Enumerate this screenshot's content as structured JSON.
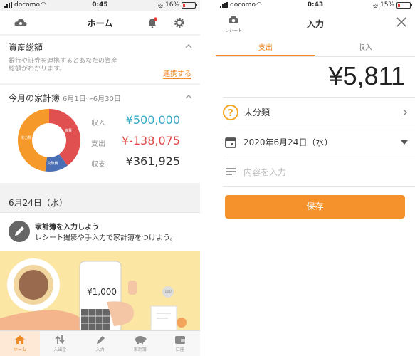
{
  "left": {
    "status": {
      "carrier": "docomo",
      "time": "0:45",
      "battery": "16%"
    },
    "nav": {
      "title": "ホーム",
      "cloud_icon": "cloud-icon",
      "bell_icon": "bell-icon",
      "gear_icon": "gear-icon"
    },
    "assets": {
      "title": "資産総額",
      "desc_line1": "銀行や証券を連携するとあなたの資産",
      "desc_line2": "総額がわかります。",
      "link": "連携する"
    },
    "monthly": {
      "title": "今月の家計簿",
      "range": "6月1日〜6月30日",
      "income_label": "収入",
      "income_value": "¥500,000",
      "expense_label": "支出",
      "expense_value": "¥-138,075",
      "balance_label": "収支",
      "balance_value": "¥361,925",
      "donut_labels": [
        "食費",
        "交際費",
        "未分類"
      ]
    },
    "date_header": "6月24日（水）",
    "prompt": {
      "title": "家計簿を入力しよう",
      "desc": "レシート撮影や手入力で家計簿をつけよう。"
    },
    "illustration": {
      "phone_amount": "¥1,000",
      "coin": "100"
    },
    "tabs": [
      "ホーム",
      "入出金",
      "入力",
      "家計簿",
      "口座"
    ]
  },
  "right": {
    "status": {
      "carrier": "docomo",
      "time": "0:43",
      "battery": "15%"
    },
    "nav": {
      "title": "入力",
      "receipt_label": "レシート"
    },
    "segments": [
      "支出",
      "収入"
    ],
    "amount": "¥5,811",
    "category": "未分類",
    "date": "2020年6月24日（水）",
    "memo_placeholder": "内容を入力",
    "save_label": "保存"
  },
  "colors": {
    "accent": "#f08a24",
    "income": "#38a8c8",
    "expense": "#e04848",
    "donut_food": "#e05050",
    "donut_social": "#4a6fb5",
    "donut_unclassified": "#f59a2a",
    "illustration_bg": "#fbe7a3"
  },
  "donut_share": {
    "food": 0.4,
    "social": 0.12,
    "unclassified": 0.48
  }
}
